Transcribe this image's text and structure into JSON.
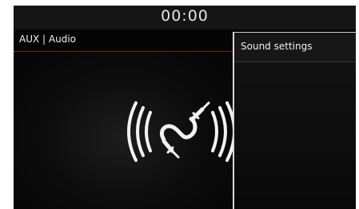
{
  "status_bar": {
    "clock": "00:00"
  },
  "source": {
    "title": "AUX | Audio"
  },
  "main": {
    "icon": "aux-cable-icon"
  },
  "panel": {
    "title": "Sound settings"
  },
  "colors": {
    "accent_line": "#8b1a1a",
    "background": "#050505",
    "text": "#f0f0f0"
  }
}
